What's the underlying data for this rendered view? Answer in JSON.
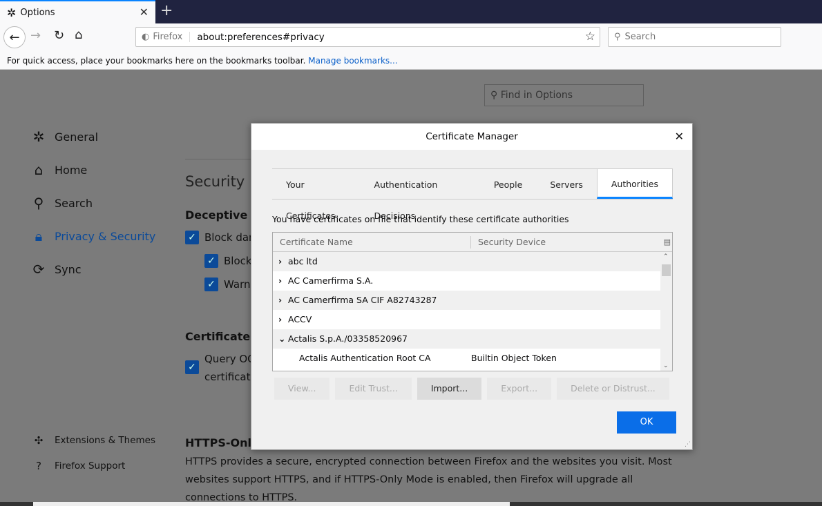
{
  "browser": {
    "tab_title": "Options",
    "url_identity": "Firefox",
    "url": "about:preferences#privacy",
    "search_placeholder": "Search",
    "bookmarks_msg": "For quick access, place your bookmarks here on the bookmarks toolbar.",
    "manage_bookmarks": "Manage bookmarks..."
  },
  "prefs": {
    "find_placeholder": "Find in Options",
    "sidebar": [
      {
        "label": "General",
        "icon": "gear-icon"
      },
      {
        "label": "Home",
        "icon": "home-icon"
      },
      {
        "label": "Search",
        "icon": "search-icon"
      },
      {
        "label": "Privacy & Security",
        "icon": "lock-icon"
      },
      {
        "label": "Sync",
        "icon": "sync-icon"
      }
    ],
    "footer": [
      {
        "label": "Extensions & Themes",
        "icon": "puzzle-icon"
      },
      {
        "label": "Firefox Support",
        "icon": "help-icon"
      }
    ],
    "security_heading": "Security",
    "deceptive_heading": "Deceptive Co",
    "block_dangerous": "Block dang",
    "block": "Block",
    "warn": "Warn y",
    "certificates_heading": "Certificates",
    "query_ocsp": "Query OCS",
    "certificates_word": "certificates",
    "https_heading": "HTTPS-Only",
    "https_line1": "HTTPS provides a secure, encrypted connection between Firefox and the websites you visit. Most",
    "https_line2": "websites support HTTPS, and if HTTPS-Only Mode is enabled, then Firefox will upgrade all",
    "https_line3": "connections to HTTPS."
  },
  "dialog": {
    "title": "Certificate Manager",
    "tabs": [
      "Your Certificates",
      "Authentication Decisions",
      "People",
      "Servers",
      "Authorities"
    ],
    "selected_tab": "Authorities",
    "description": "You have certificates on file that identify these certificate authorities",
    "columns": [
      "Certificate Name",
      "Security Device"
    ],
    "rows": [
      {
        "name": "abc ltd",
        "device": "",
        "expanded": false
      },
      {
        "name": "AC Camerfirma S.A.",
        "device": "",
        "expanded": false
      },
      {
        "name": "AC Camerfirma SA CIF A82743287",
        "device": "",
        "expanded": false
      },
      {
        "name": "ACCV",
        "device": "",
        "expanded": false
      },
      {
        "name": "Actalis S.p.A./03358520967",
        "device": "",
        "expanded": true
      },
      {
        "name": "Actalis Authentication Root CA",
        "device": "Builtin Object Token",
        "child": true
      }
    ],
    "buttons": [
      {
        "label": "View...",
        "enabled": false
      },
      {
        "label": "Edit Trust...",
        "enabled": false
      },
      {
        "label": "Import...",
        "enabled": true
      },
      {
        "label": "Export...",
        "enabled": false
      },
      {
        "label": "Delete or Distrust...",
        "enabled": false
      }
    ],
    "ok": "OK"
  },
  "colors": {
    "accent": "#0a84ff",
    "ok_button": "#0a6ee8",
    "selected_nav": "#0b4a99"
  }
}
